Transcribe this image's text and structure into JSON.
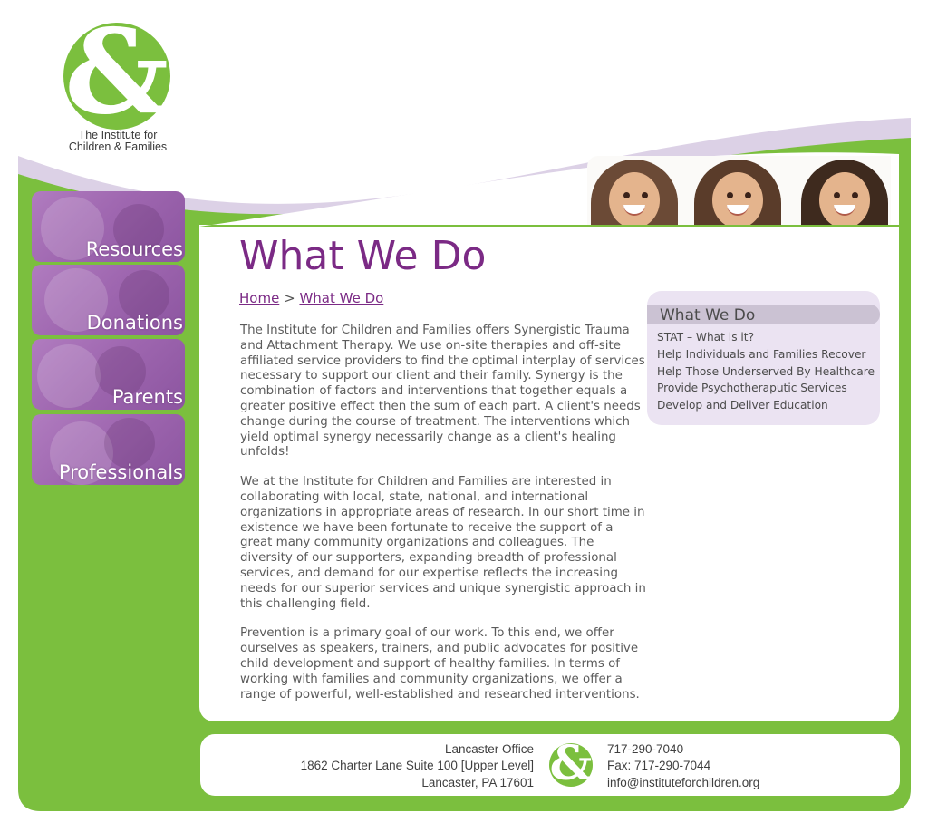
{
  "brand": {
    "logo_symbol": "&",
    "logo_line1": "The Institute for",
    "logo_line2": "Children & Families",
    "green": "#7bbf3e",
    "purple": "#7b2a85",
    "lavender": "#ebe3f2"
  },
  "nav": {
    "items": [
      {
        "label": "Resources"
      },
      {
        "label": "Donations"
      },
      {
        "label": "Parents"
      },
      {
        "label": "Professionals"
      }
    ]
  },
  "main": {
    "title": "What We Do",
    "breadcrumb": {
      "home": "Home",
      "separator": ">",
      "current": "What We Do"
    },
    "paragraphs": [
      "The Institute for Children and Families offers Synergistic Trauma and Attachment Therapy. We use on-site therapies and off-site affiliated service providers to find the optimal interplay of services necessary to support our client and their family. Synergy is the combination of factors and interventions that together equals a greater positive effect then the sum of each part. A client's needs change during the course of treatment. The interventions which yield optimal synergy necessarily change as a client's healing unfolds!",
      "We at the Institute for Children and Families are interested in collaborating with local, state, national, and international organizations in appropriate areas of research. In our short time in existence we have been fortunate to receive the support of a great many community organizations and colleagues. The diversity of our supporters, expanding breadth of professional services, and demand for our expertise reflects the increasing needs for our superior services and unique synergistic approach in this challenging field.",
      "Prevention is a primary goal of our work. To this end, we offer ourselves as speakers, trainers, and public advocates for positive child development and support of healthy families. In terms of working with families and community organizations, we offer a range of powerful, well-established and researched interventions."
    ]
  },
  "sidebox": {
    "title": "What We Do",
    "links": [
      "STAT – What is it?",
      "Help Individuals and Families Recover",
      "Help Those Underserved By Healthcare",
      "Provide Psychotheraputic Services",
      "Develop and Deliver Education"
    ]
  },
  "footer": {
    "office": "Lancaster Office",
    "street": "1862 Charter Lane Suite 100 [Upper Level]",
    "city": "Lancaster, PA 17601",
    "phone": "717-290-7040",
    "fax": "Fax: 717-290-7044",
    "email": "info@instituteforchildren.org",
    "logo_symbol": "&"
  }
}
